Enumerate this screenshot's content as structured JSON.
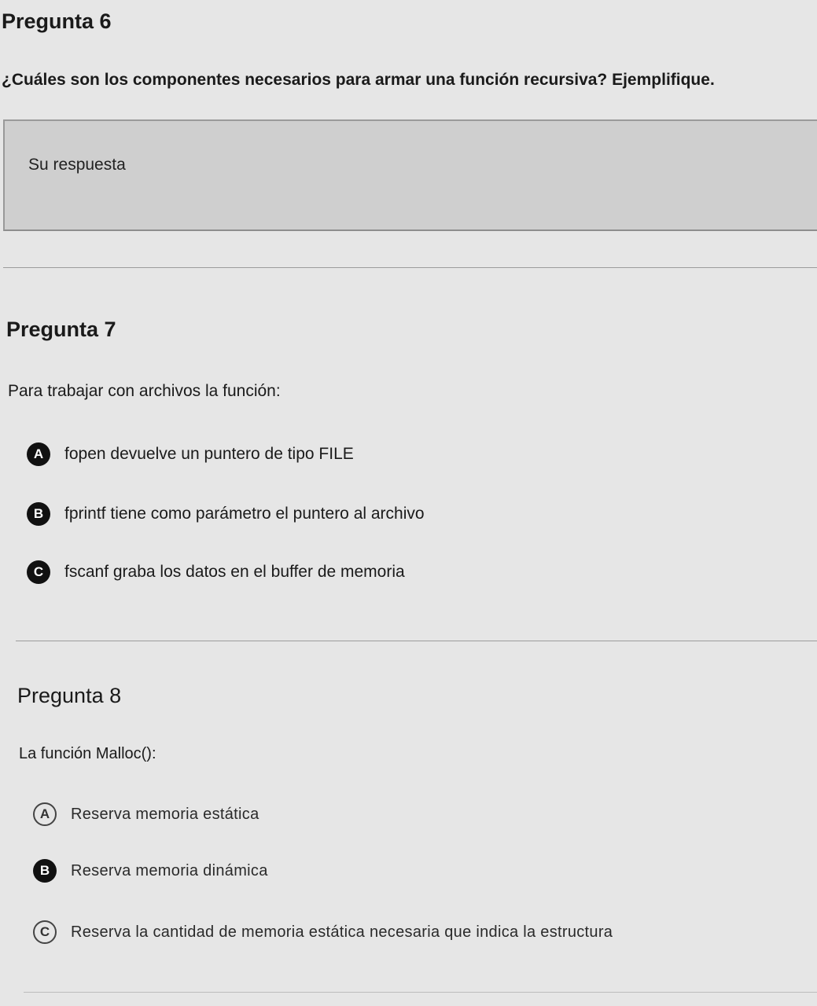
{
  "q6": {
    "title": "Pregunta 6",
    "text": "¿Cuáles son los componentes necesarios para armar una función recursiva? Ejemplifique.",
    "answer_label": "Su respuesta"
  },
  "q7": {
    "title": "Pregunta 7",
    "text": "Para trabajar con archivos la función:",
    "options": [
      {
        "letter": "A",
        "text": "fopen devuelve un puntero de tipo FILE"
      },
      {
        "letter": "B",
        "text": "fprintf tiene como parámetro el puntero al archivo"
      },
      {
        "letter": "C",
        "text": "fscanf graba los datos en el buffer de memoria"
      }
    ]
  },
  "q8": {
    "title": "Pregunta 8",
    "text": "La función Malloc():",
    "options": [
      {
        "letter": "A",
        "text": "Reserva memoria estática"
      },
      {
        "letter": "B",
        "text": "Reserva memoria dinámica"
      },
      {
        "letter": "C",
        "text": "Reserva la cantidad de memoria estática necesaria que indica la estructura"
      }
    ]
  }
}
